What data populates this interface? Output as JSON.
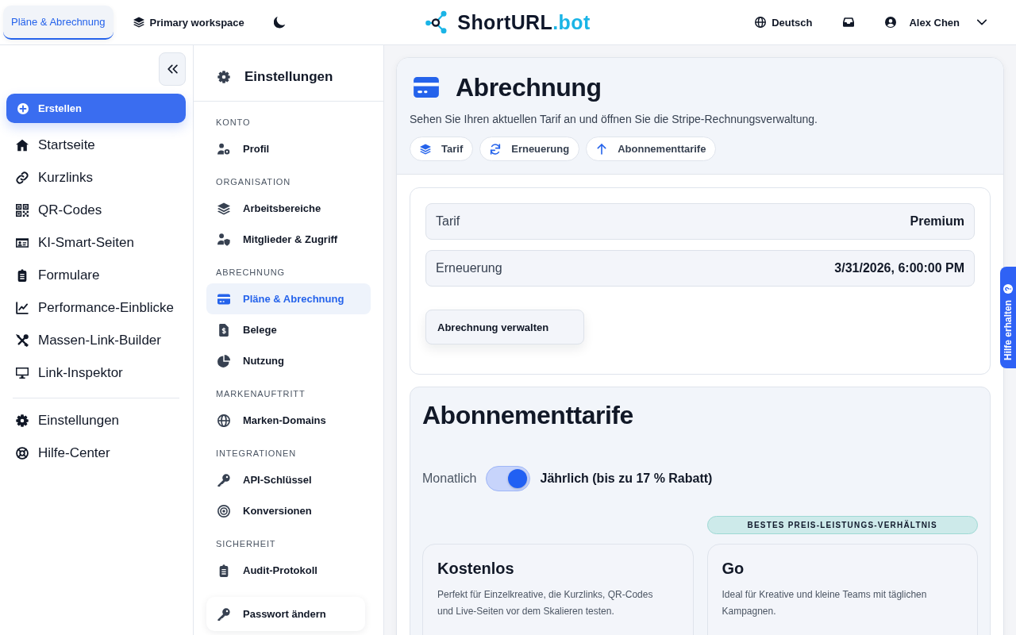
{
  "top_bar": {
    "tabs": [
      {
        "label": "Pläne & Abrechnung",
        "selected": true
      }
    ],
    "workspace": "Primary workspace",
    "logo": {
      "name": "ShortURL",
      "suffix": ".bot"
    },
    "language": "Deutsch",
    "user": "Alex Chen"
  },
  "sidebar": {
    "create_button": "Erstellen",
    "items": [
      {
        "label": "Startseite",
        "selected": false
      },
      {
        "label": "Kurzlinks",
        "selected": false
      },
      {
        "label": "QR-Codes",
        "selected": false
      },
      {
        "label": "KI-Smart-Seiten",
        "selected": false
      },
      {
        "label": "Formulare",
        "selected": false
      },
      {
        "label": "Performance-Einblicke",
        "selected": false
      },
      {
        "label": "Massen-Link-Builder",
        "selected": false
      },
      {
        "label": "Link-Inspektor",
        "selected": false
      }
    ],
    "footer_items": [
      {
        "label": "Einstellungen",
        "selected": false
      },
      {
        "label": "Hilfe-Center",
        "selected": false
      }
    ]
  },
  "settings_nav": {
    "title": "Einstellungen",
    "sections": [
      {
        "label": "KONTO",
        "items": [
          {
            "label": "Profil",
            "selected": false
          }
        ]
      },
      {
        "label": "ORGANISATION",
        "items": [
          {
            "label": "Arbeitsbereiche",
            "selected": false
          },
          {
            "label": "Mitglieder & Zugriff",
            "selected": false
          }
        ]
      },
      {
        "label": "ABRECHNUNG",
        "items": [
          {
            "label": "Pläne & Abrechnung",
            "selected": true
          },
          {
            "label": "Belege",
            "selected": false
          },
          {
            "label": "Nutzung",
            "selected": false
          }
        ]
      },
      {
        "label": "MARKENAUFTRITT",
        "items": [
          {
            "label": "Marken-Domains",
            "selected": false
          }
        ]
      },
      {
        "label": "INTEGRATIONEN",
        "items": [
          {
            "label": "API-Schlüssel",
            "selected": false
          },
          {
            "label": "Konversionen",
            "selected": false
          }
        ]
      },
      {
        "label": "SICHERHEIT",
        "items": [
          {
            "label": "Audit-Protokoll",
            "selected": false
          }
        ]
      }
    ],
    "footer_item": "Passwort ändern"
  },
  "billing": {
    "title": "Abrechnung",
    "subtitle": "Sehen Sie Ihren aktuellen Tarif an und öffnen Sie die Stripe-Rechnungsverwaltung.",
    "anchors": [
      "Tarif",
      "Erneuerung",
      "Abonnementtarife"
    ],
    "details": [
      {
        "label": "Tarif",
        "value": "Premium"
      },
      {
        "label": "Erneuerung",
        "value": "3/31/2026, 6:00:00 PM"
      }
    ],
    "manage_button": "Abrechnung verwalten"
  },
  "subscriptions": {
    "title": "Abonnementtarife",
    "billing_toggle": {
      "monthly_label": "Monatlich",
      "annual_label": "Jährlich (bis zu 17 % Rabatt)",
      "on": true
    },
    "plans": [
      {
        "name": "Kostenlos",
        "description": "Perfekt für Einzelkreative, die Kurzlinks, QR-Codes und Live-Seiten vor dem Skalieren testen."
      },
      {
        "name": "Go",
        "badge": "BESTES PREIS-LEISTUNGS-VERHÄLTNIS",
        "description": "Ideal für Kreative und kleine Teams mit täglichen Kampagnen."
      }
    ]
  },
  "help_tab": "Hilfe erhalten"
}
